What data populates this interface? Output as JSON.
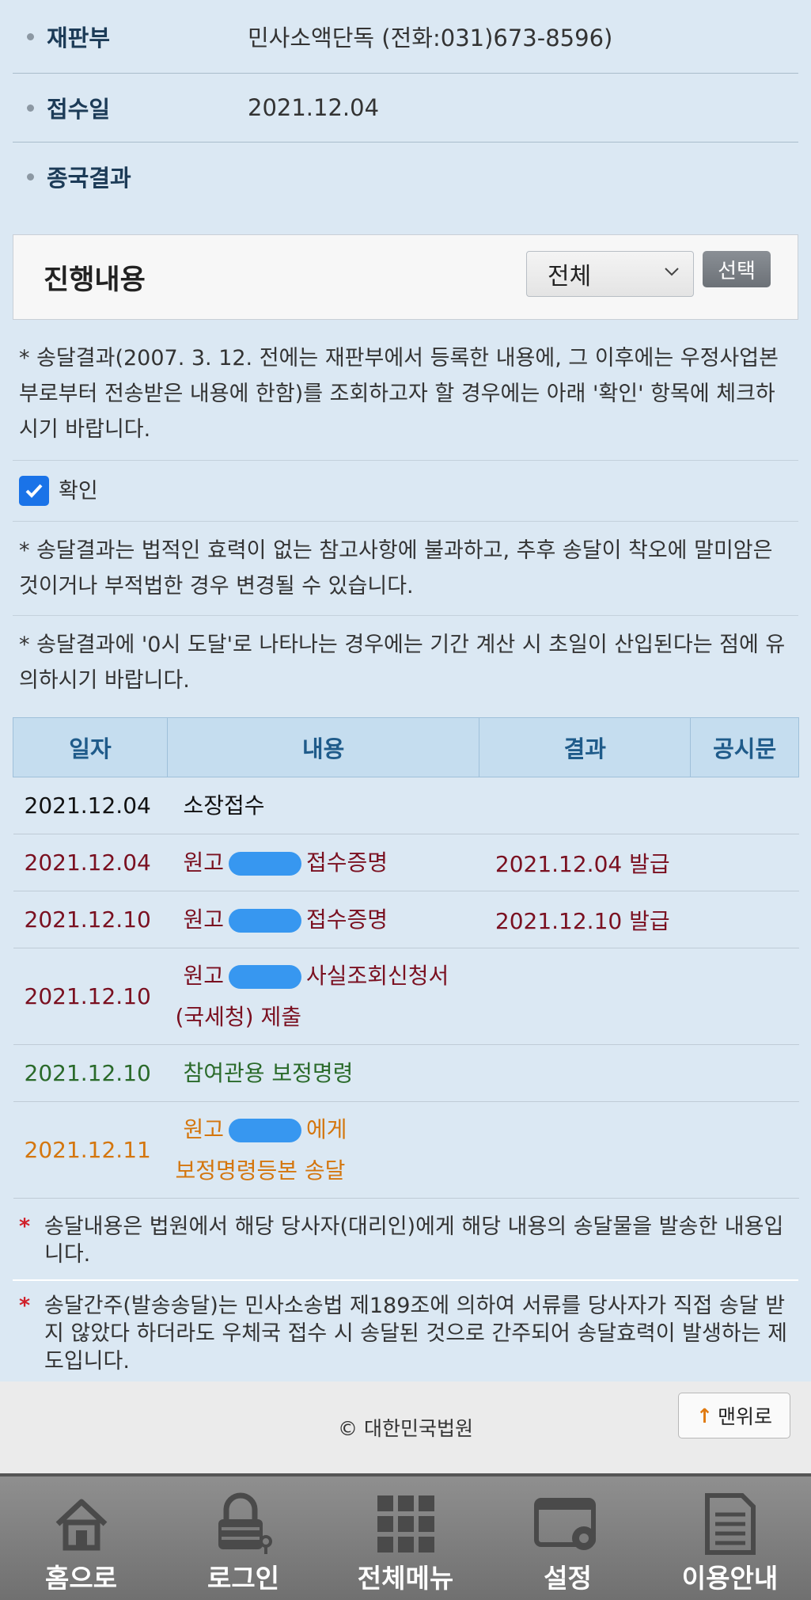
{
  "case_info": [
    {
      "label": "재판부",
      "value": "민사소액단독 (전화:031)673-8596)"
    },
    {
      "label": "접수일",
      "value": "2021.12.04"
    },
    {
      "label": "종국결과",
      "value": ""
    }
  ],
  "progress": {
    "title": "진행내용",
    "filter_value": "전체",
    "select_button": "선택"
  },
  "notices": {
    "delivery_query": "* 송달결과(2007. 3. 12. 전에는 재판부에서 등록한 내용에, 그 이후에는 우정사업본부로부터 전송받은 내용에 한함)를 조회하고자 할 경우에는 아래 '확인' 항목에 체크하시기 바랍니다.",
    "confirm_label": "확인",
    "legal_effect": "* 송달결과는 법적인 효력이 없는 참고사항에 불과하고, 추후 송달이 착오에 말미암은 것이거나 부적법한 경우 변경될 수 있습니다.",
    "zero_hour": "* 송달결과에 '0시 도달'로 나타나는 경우에는 기간 계산 시 초일이 산입된다는 점에 유의하시기 바랍니다."
  },
  "table": {
    "headers": [
      "일자",
      "내용",
      "결과",
      "공시문"
    ],
    "rows": [
      {
        "date": "2021.12.04",
        "pre": "소장접수",
        "post": "",
        "line2": "",
        "result": ""
      },
      {
        "date": "2021.12.04",
        "pre": "원고",
        "post": "접수증명",
        "line2": "",
        "result": "2021.12.04 발급"
      },
      {
        "date": "2021.12.10",
        "pre": "원고",
        "post": "접수증명",
        "line2": "",
        "result": "2021.12.10 발급"
      },
      {
        "date": "2021.12.10",
        "pre": "원고",
        "post": "사실조회신청서",
        "line2": "(국세청) 제출",
        "result": ""
      },
      {
        "date": "2021.12.10",
        "pre": "참여관용 보정명령",
        "post": "",
        "line2": "",
        "result": ""
      },
      {
        "date": "2021.12.11",
        "pre": "원고",
        "post": "에게",
        "line2": "보정명령등본 송달",
        "result": ""
      }
    ]
  },
  "footnotes": {
    "f1": "송달내용은 법원에서 해당 당사자(대리인)에게 해당 내용의 송달물을 발송한 내용입니다.",
    "f2": "송달간주(발송송달)는 민사소송법 제189조에 의하여 서류를 당사자가 직접 송달 받지 않았다 하더라도 우체국 접수 시 송달된 것으로 간주되어 송달효력이 발생하는 제도입니다."
  },
  "footer": {
    "copyright": "© 대한민국법원",
    "top_button": "맨위로"
  },
  "nav": [
    {
      "label": "홈으로",
      "icon": "home-icon"
    },
    {
      "label": "로그인",
      "icon": "lock-icon"
    },
    {
      "label": "전체메뉴",
      "icon": "grid-menu-icon"
    },
    {
      "label": "설정",
      "icon": "settings-icon"
    },
    {
      "label": "이용안내",
      "icon": "document-icon"
    }
  ]
}
